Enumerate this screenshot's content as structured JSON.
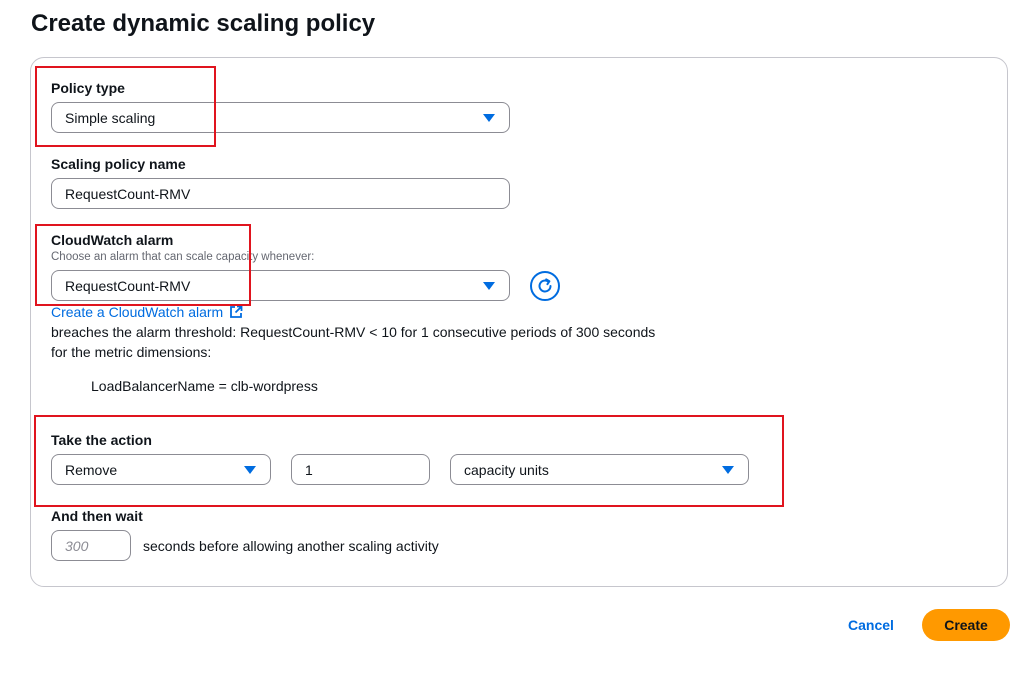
{
  "page": {
    "title": "Create dynamic scaling policy"
  },
  "policy_type": {
    "label": "Policy type",
    "value": "Simple scaling"
  },
  "policy_name": {
    "label": "Scaling policy name",
    "value": "RequestCount-RMV"
  },
  "cloudwatch_alarm": {
    "label": "CloudWatch alarm",
    "description": "Choose an alarm that can scale capacity whenever:",
    "value": "RequestCount-RMV",
    "create_link": "Create a CloudWatch alarm",
    "breach_text": "breaches the alarm threshold: RequestCount-RMV < 10 for 1 consecutive periods of 300 seconds",
    "dimensions_text": "for the metric dimensions:",
    "dimension": "LoadBalancerName = clb-wordpress"
  },
  "action": {
    "label": "Take the action",
    "operation": "Remove",
    "amount": "1",
    "unit": "capacity units"
  },
  "wait": {
    "label": "And then wait",
    "placeholder": "300",
    "suffix": "seconds before allowing another scaling activity"
  },
  "footer": {
    "cancel": "Cancel",
    "create": "Create"
  },
  "colors": {
    "accent": "#006ce0",
    "primary_button": "#ff9900",
    "highlight": "#e0141e"
  },
  "icons": {
    "refresh": "refresh-icon",
    "external_link": "external-link-icon",
    "dropdown": "caret-down-icon"
  }
}
